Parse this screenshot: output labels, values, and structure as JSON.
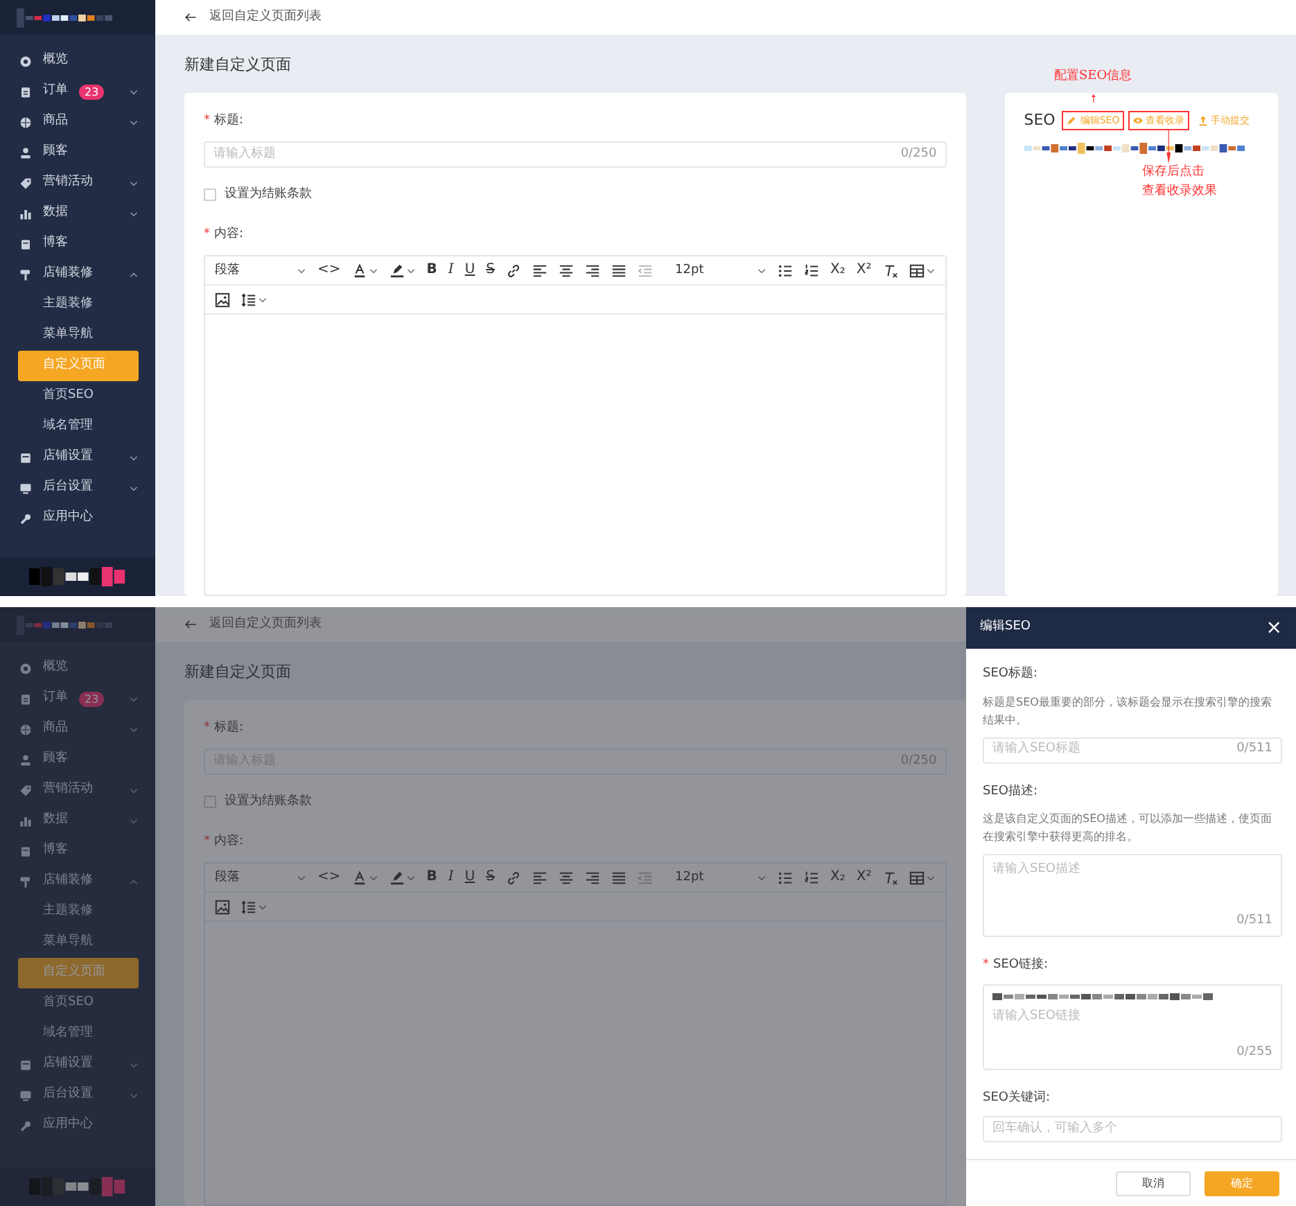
{
  "screens": [
    {
      "kind": "page",
      "sidebar": {
        "items": [
          {
            "label": "概览"
          },
          {
            "label": "订单",
            "badge": "23",
            "expanded": false
          },
          {
            "label": "商品",
            "expanded": false
          },
          {
            "label": "顾客"
          },
          {
            "label": "营销活动",
            "expanded": false
          },
          {
            "label": "数据",
            "expanded": false
          },
          {
            "label": "博客"
          },
          {
            "label": "店铺装修",
            "expanded": true,
            "children": [
              {
                "label": "主题装修",
                "selected": false
              },
              {
                "label": "菜单导航",
                "selected": false
              },
              {
                "label": "自定义页面",
                "selected": true
              },
              {
                "label": "首页SEO",
                "selected": false
              },
              {
                "label": "域名管理",
                "selected": false
              }
            ]
          },
          {
            "label": "店铺设置",
            "expanded": false
          },
          {
            "label": "后台设置",
            "expanded": false
          },
          {
            "label": "应用中心"
          }
        ]
      },
      "back_link": "返回自定义页面列表",
      "page_title": "新建自定义页面",
      "form": {
        "title_required_mark": "*",
        "title_label": "标题:",
        "title_placeholder": "请输入标题",
        "title_counter": "0/250",
        "checkbox": {
          "label": "设置为结账条款",
          "checked": false
        },
        "content_required_mark": "*",
        "content_label": "内容:",
        "toolbar_rows": [
          [
            {
              "kind": "select",
              "label": "段落",
              "disabled": false
            },
            {
              "kind": "code",
              "label": "<>",
              "disabled": false
            },
            {
              "kind": "font-color",
              "disabled": false
            },
            {
              "kind": "highlight",
              "disabled": false
            },
            {
              "kind": "bold",
              "label": "B",
              "disabled": false
            },
            {
              "kind": "italic",
              "label": "I",
              "disabled": false
            },
            {
              "kind": "underline",
              "label": "U",
              "disabled": false
            },
            {
              "kind": "strike",
              "label": "S",
              "disabled": false
            },
            {
              "kind": "link",
              "disabled": false
            },
            {
              "kind": "align-left",
              "disabled": false
            },
            {
              "kind": "align-center",
              "disabled": false
            },
            {
              "kind": "align-right",
              "disabled": false
            },
            {
              "kind": "justify",
              "disabled": false
            },
            {
              "kind": "outdent",
              "disabled": true
            },
            {
              "kind": "select",
              "label": "12pt",
              "disabled": false
            },
            {
              "kind": "bullets",
              "disabled": false
            },
            {
              "kind": "numbers",
              "disabled": false
            },
            {
              "kind": "script",
              "label": "X₂",
              "disabled": false
            },
            {
              "kind": "script",
              "label": "X²",
              "disabled": false
            },
            {
              "kind": "clear-format",
              "disabled": false
            },
            {
              "kind": "table",
              "disabled": false
            }
          ],
          [
            {
              "kind": "image",
              "disabled": false
            },
            {
              "kind": "line-height",
              "disabled": false
            }
          ]
        ]
      },
      "seo_card": {
        "title": "SEO",
        "actions": [
          {
            "kind": "edit",
            "label": "编辑SEO",
            "highlighted": true,
            "note": {
              "kind": "above",
              "lines": [
                "配置SEO信息"
              ]
            }
          },
          {
            "kind": "view",
            "label": "查看收录",
            "highlighted": true,
            "note": {
              "kind": "below",
              "lines": [
                "保存后点击",
                "查看收录效果"
              ]
            }
          },
          {
            "kind": "submit",
            "label": "手动提交",
            "highlighted": false
          }
        ]
      }
    },
    {
      "kind": "page_with_drawer",
      "sidebar": {
        "items": [
          {
            "label": "概览"
          },
          {
            "label": "订单",
            "badge": "23",
            "expanded": false
          },
          {
            "label": "商品",
            "expanded": false
          },
          {
            "label": "顾客"
          },
          {
            "label": "营销活动",
            "expanded": false
          },
          {
            "label": "数据",
            "expanded": false
          },
          {
            "label": "博客"
          },
          {
            "label": "店铺装修",
            "expanded": true,
            "children": [
              {
                "label": "主题装修",
                "selected": false
              },
              {
                "label": "菜单导航",
                "selected": false
              },
              {
                "label": "自定义页面",
                "selected": true
              },
              {
                "label": "首页SEO",
                "selected": false
              },
              {
                "label": "域名管理",
                "selected": false
              }
            ]
          },
          {
            "label": "店铺设置",
            "expanded": false
          },
          {
            "label": "后台设置",
            "expanded": false
          },
          {
            "label": "应用中心"
          }
        ]
      },
      "back_link": "返回自定义页面列表",
      "page_title": "新建自定义页面",
      "form": {
        "title_required_mark": "*",
        "title_label": "标题:",
        "title_placeholder": "请输入标题",
        "title_counter": "0/250",
        "checkbox": {
          "label": "设置为结账条款",
          "checked": false
        },
        "content_required_mark": "*",
        "content_label": "内容:",
        "toolbar_rows": [
          [
            {
              "kind": "select",
              "label": "段落",
              "disabled": false
            },
            {
              "kind": "code",
              "label": "<>",
              "disabled": false
            },
            {
              "kind": "font-color",
              "disabled": false
            },
            {
              "kind": "highlight",
              "disabled": false
            },
            {
              "kind": "bold",
              "label": "B",
              "disabled": false
            },
            {
              "kind": "italic",
              "label": "I",
              "disabled": false
            },
            {
              "kind": "underline",
              "label": "U",
              "disabled": false
            },
            {
              "kind": "strike",
              "label": "S",
              "disabled": false
            },
            {
              "kind": "link",
              "disabled": false
            },
            {
              "kind": "align-left",
              "disabled": false
            },
            {
              "kind": "align-center",
              "disabled": false
            },
            {
              "kind": "align-right",
              "disabled": false
            },
            {
              "kind": "justify",
              "disabled": false
            },
            {
              "kind": "outdent",
              "disabled": true
            },
            {
              "kind": "select",
              "label": "12pt",
              "disabled": false
            },
            {
              "kind": "bullets",
              "disabled": false
            },
            {
              "kind": "numbers",
              "disabled": false
            },
            {
              "kind": "script",
              "label": "X₂",
              "disabled": false
            },
            {
              "kind": "script",
              "label": "X²",
              "disabled": false
            },
            {
              "kind": "clear-format",
              "disabled": false
            },
            {
              "kind": "table",
              "disabled": false
            }
          ],
          [
            {
              "kind": "image",
              "disabled": false
            },
            {
              "kind": "line-height",
              "disabled": false
            }
          ]
        ]
      },
      "drawer": {
        "title": "编辑SEO",
        "close": "×",
        "fields": [
          {
            "kind": "input",
            "label": "SEO标题:",
            "help": "标题是SEO最重要的部分，该标题会显示在搜索引擎的搜索结果中。",
            "placeholder": "请输入SEO标题",
            "counter": "0/511"
          },
          {
            "kind": "textarea",
            "label": "SEO描述:",
            "help": "这是该自定义页面的SEO描述，可以添加一些描述，使页面在搜索引擎中获得更高的排名。",
            "placeholder": "请输入SEO描述",
            "counter": "0/511"
          },
          {
            "kind": "link",
            "label": "SEO链接:",
            "required_mark": "*",
            "placeholder": "请输入SEO链接",
            "counter": "0/255"
          },
          {
            "kind": "input",
            "label": "SEO关键词:",
            "placeholder": "回车确认，可输入多个"
          }
        ],
        "buttons": [
          {
            "kind": "secondary",
            "label": "取消"
          },
          {
            "kind": "primary",
            "label": "确定"
          }
        ]
      }
    }
  ]
}
